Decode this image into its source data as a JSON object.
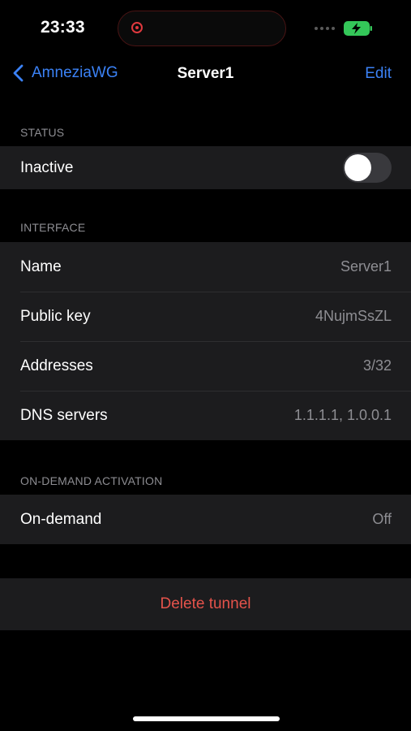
{
  "status_bar": {
    "time": "23:33"
  },
  "nav": {
    "back_label": "AmneziaWG",
    "title": "Server1",
    "edit_label": "Edit"
  },
  "status_section": {
    "header": "STATUS",
    "state_label": "Inactive",
    "toggle_on": false
  },
  "interface_section": {
    "header": "INTERFACE",
    "rows": [
      {
        "label": "Name",
        "value": "Server1"
      },
      {
        "label": "Public key",
        "value": "4NujmSsZL"
      },
      {
        "label": "Addresses",
        "value": "3/32"
      },
      {
        "label": "DNS servers",
        "value": "1.1.1.1, 1.0.0.1"
      }
    ]
  },
  "on_demand_section": {
    "header": "ON-DEMAND ACTIVATION",
    "rows": [
      {
        "label": "On-demand",
        "value": "Off"
      }
    ]
  },
  "delete": {
    "label": "Delete tunnel"
  },
  "colors": {
    "accent": "#3b82f6",
    "destructive": "#e5534b",
    "background": "#000000",
    "cell": "#1c1c1e"
  }
}
